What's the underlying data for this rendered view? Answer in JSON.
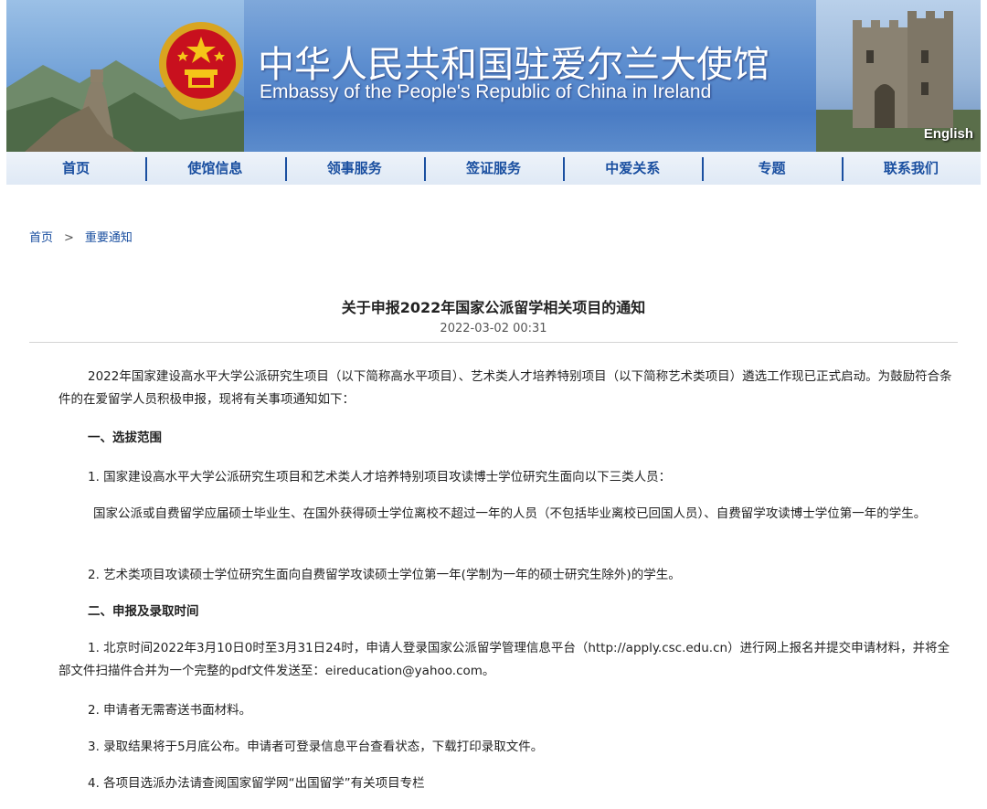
{
  "header": {
    "title_cn": "中华人民共和国驻爱尔兰大使馆",
    "title_en": "Embassy of the People's Republic of China in Ireland",
    "english_link": "English"
  },
  "nav": {
    "items": [
      {
        "label": "首页"
      },
      {
        "label": "使馆信息"
      },
      {
        "label": "领事服务"
      },
      {
        "label": "签证服务"
      },
      {
        "label": "中爱关系"
      },
      {
        "label": "专题"
      },
      {
        "label": "联系我们"
      }
    ]
  },
  "breadcrumb": {
    "home": "首页",
    "separator": ">",
    "current": "重要通知"
  },
  "article": {
    "title": "关于申报2022年国家公派留学相关项目的通知",
    "date": "2022-03-02 00:31",
    "intro": "2022年国家建设高水平大学公派研究生项目（以下简称高水平项目）、艺术类人才培养特别项目（以下简称艺术类项目）遴选工作现已正式启动。为鼓励符合条件的在爱留学人员积极申报，现将有关事项通知如下：",
    "section1_heading": "一、选拔范围",
    "s1_item1": "1. 国家建设高水平大学公派研究生项目和艺术类人才培养特别项目攻读博士学位研究生面向以下三类人员：",
    "s1_item1_detail": "国家公派或自费留学应届硕士毕业生、在国外获得硕士学位离校不超过一年的人员（不包括毕业离校已回国人员）、自费留学攻读博士学位第一年的学生。",
    "s1_item2": "2. 艺术类项目攻读硕士学位研究生面向自费留学攻读硕士学位第一年(学制为一年的硕士研究生除外)的学生。",
    "section2_heading": "二、申报及录取时间",
    "s2_item1": "1. 北京时间2022年3月10日0时至3月31日24时，申请人登录国家公派留学管理信息平台（http://apply.csc.edu.cn）进行网上报名并提交申请材料，并将全部文件扫描件合并为一个完整的pdf文件发送至：eireducation@yahoo.com。",
    "s2_item2": "2. 申请者无需寄送书面材料。",
    "s2_item3": "3. 录取结果将于5月底公布。申请者可登录信息平台查看状态，下载打印录取文件。",
    "s2_item4": "4. 各项目选派办法请查阅国家留学网“出国留学”有关项目专栏"
  }
}
